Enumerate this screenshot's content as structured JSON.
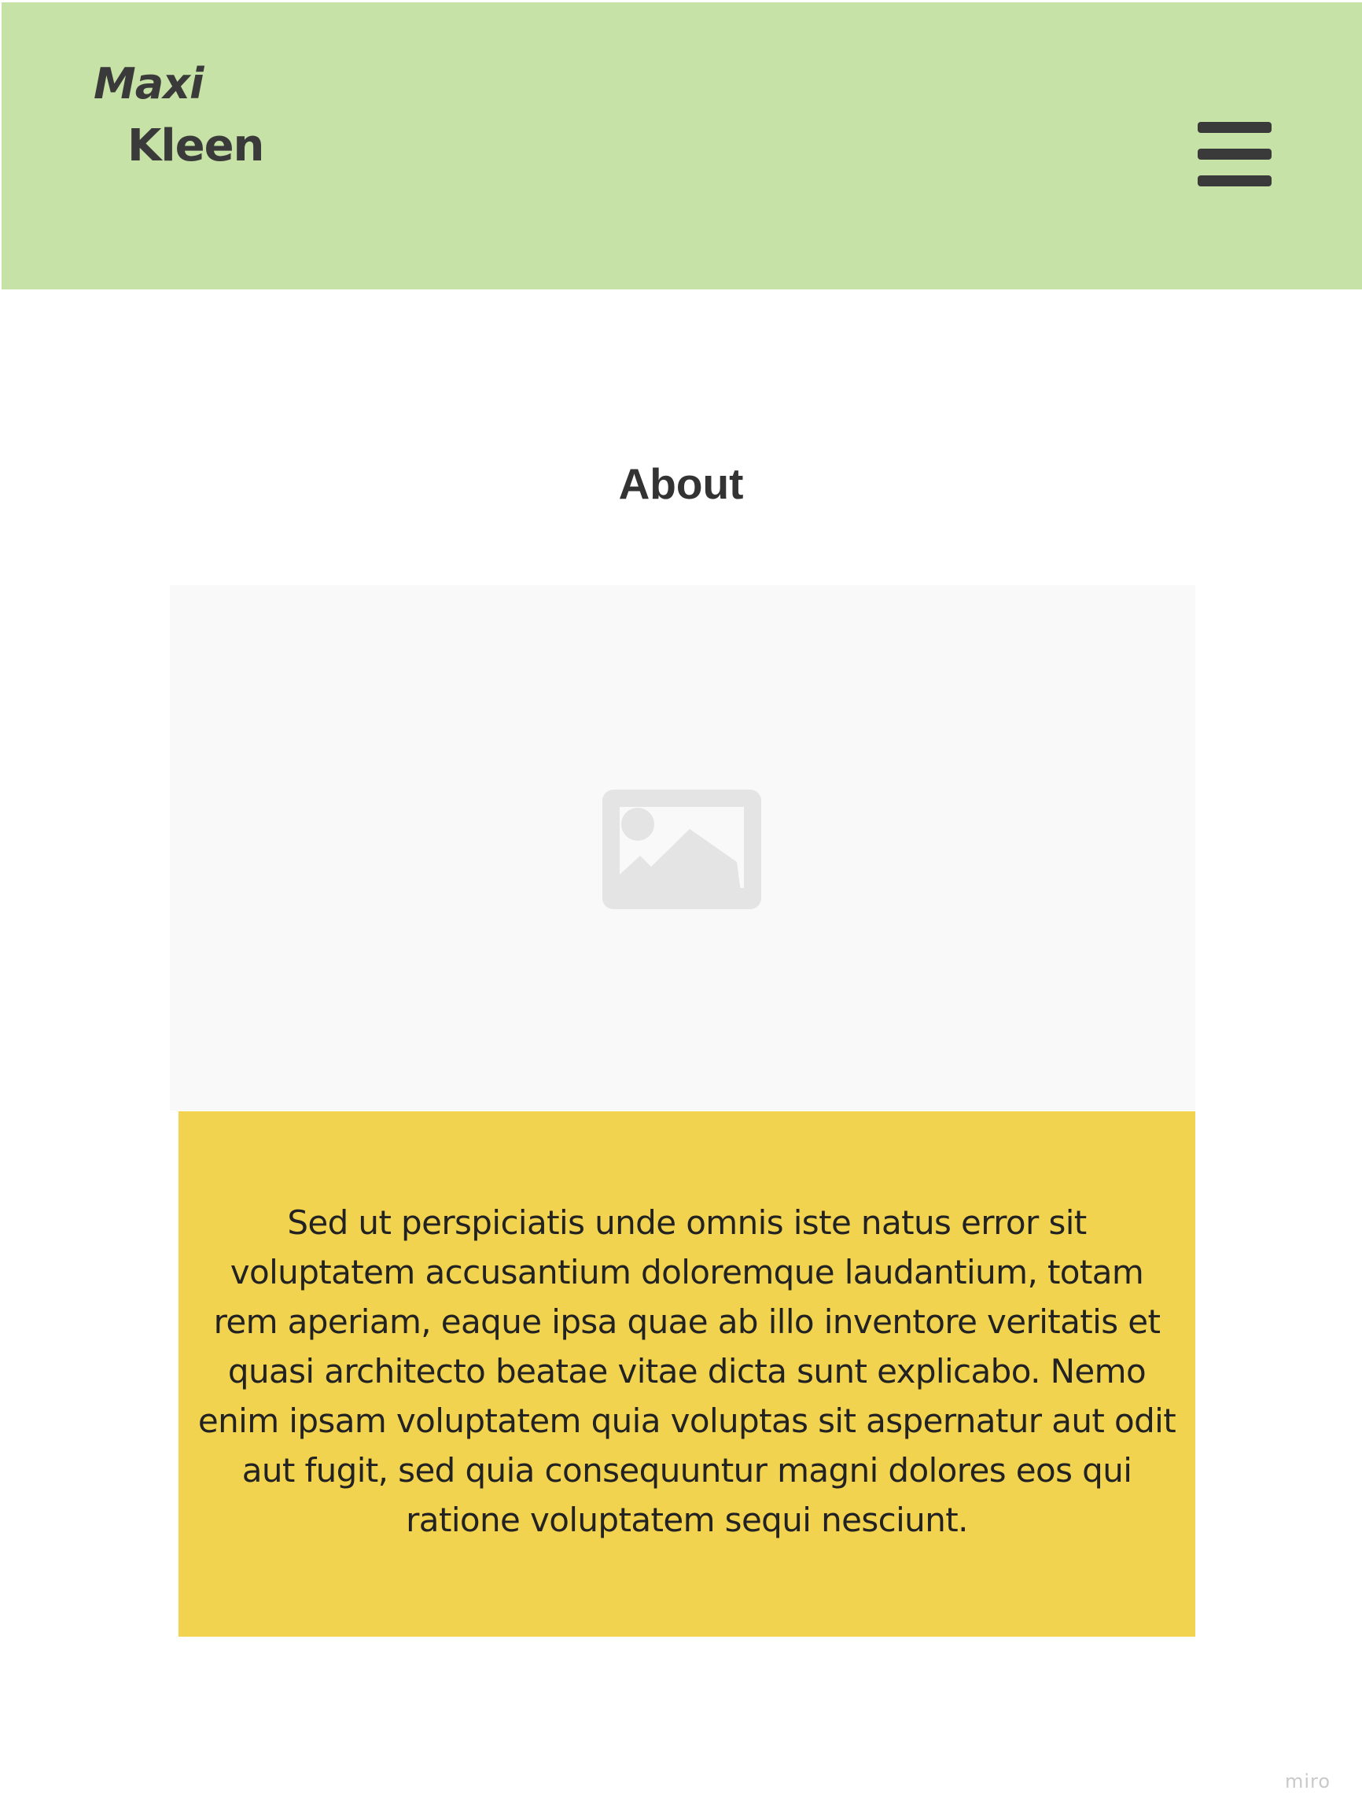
{
  "header": {
    "logo_line1": "Maxi",
    "logo_line2": "Kleen",
    "menu_icon": "hamburger-menu-icon",
    "background_color": "#c7e2a7"
  },
  "main": {
    "section_title": "About",
    "image_icon": "image-placeholder-icon",
    "card": {
      "text": "Sed ut perspiciatis unde omnis iste natus error sit voluptatem accusantium doloremque laudantium, totam rem aperiam, eaque ipsa quae ab illo inventore veritatis et quasi architecto beatae vitae dicta sunt explicabo. Nemo enim ipsam voluptatem quia voluptas sit aspernatur aut odit aut fugit, sed quia consequuntur magni dolores eos qui ratione voluptatem sequi nesciunt.",
      "background_color": "#f2d34f"
    }
  },
  "watermark": "miro"
}
